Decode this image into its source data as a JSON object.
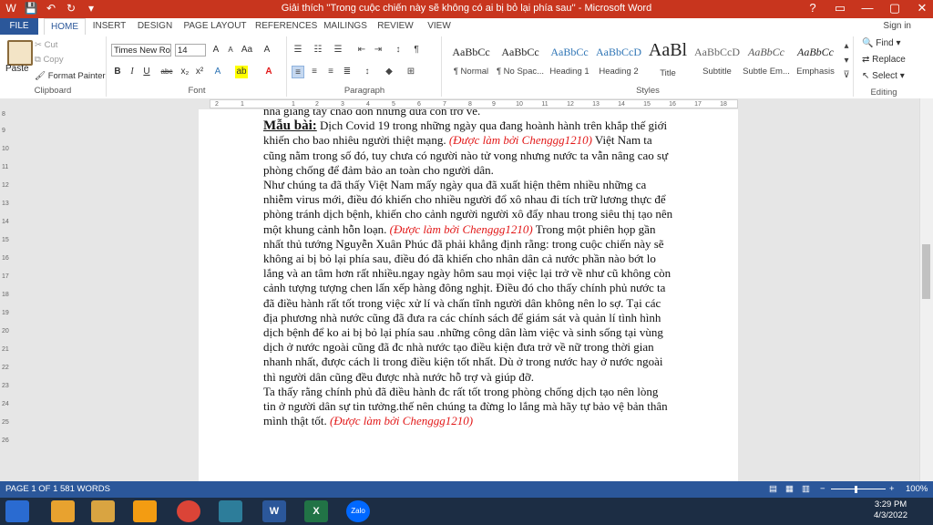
{
  "window": {
    "title": "Giải thích ''Trong cuộc chiến này sẽ không có ai bị bỏ lại phía sau'' - Microsoft Word",
    "controls": [
      "?",
      "▭",
      "—",
      "▢",
      "✕"
    ]
  },
  "tabs": [
    "FILE",
    "HOME",
    "INSERT",
    "DESIGN",
    "PAGE LAYOUT",
    "REFERENCES",
    "MAILINGS",
    "REVIEW",
    "VIEW"
  ],
  "signin": "Sign in",
  "ribbon": {
    "clipboard": {
      "paste": "Paste",
      "cut": "Cut",
      "copy": "Copy",
      "format_painter": "Format Painter",
      "label": "Clipboard"
    },
    "font": {
      "name": "Times New Ro",
      "size": "14",
      "label": "Font"
    },
    "paragraph": {
      "label": "Paragraph"
    },
    "styles": {
      "label": "Styles",
      "items": [
        {
          "sample": "AaBbCc",
          "name": "¶ Normal"
        },
        {
          "sample": "AaBbCc",
          "name": "¶ No Spac..."
        },
        {
          "sample": "AaBbCc",
          "name": "Heading 1"
        },
        {
          "sample": "AaBbCcD",
          "name": "Heading 2"
        },
        {
          "sample": "AaBl",
          "name": "Title"
        },
        {
          "sample": "AaBbCcD",
          "name": "Subtitle"
        },
        {
          "sample": "AaBbCc",
          "name": "Subtle Em..."
        },
        {
          "sample": "AaBbCc",
          "name": "Emphasis"
        }
      ]
    },
    "editing": {
      "find": "Find",
      "replace": "Replace",
      "select": "Select",
      "label": "Editing"
    }
  },
  "ruler_marks": [
    "2",
    "1",
    "1",
    "2",
    "3",
    "4",
    "5",
    "6",
    "7",
    "8",
    "9",
    "10",
    "11",
    "12",
    "13",
    "14",
    "15",
    "16",
    "17",
    "18"
  ],
  "vruler_marks": [
    "8",
    "9",
    "10",
    "11",
    "12",
    "13",
    "14",
    "15",
    "16",
    "17",
    "18",
    "19",
    "20",
    "21",
    "22",
    "23",
    "24",
    "25",
    "26"
  ],
  "document": {
    "p0": "nhà giang tay chào đón những đứa con trở về.",
    "p1_label": "Mẫu bài:",
    "p1_text": " Dịch Covid 19 trong những ngày qua đang hoành hành trên khắp thế giới khiến cho bao nhiêu người thiệt mạng. ",
    "credit": "(Được làm bởi Chenggg1210)",
    "p1_text2": " Việt Nam ta cũng nằm trong số đó, tuy chưa có người nào tử vong nhưng nước ta vẫn nâng cao sự phòng chống để đảm bảo an toàn cho người dân.",
    "p2_text": "Như chúng ta đã thấy Việt Nam mấy ngày qua đã xuất hiện thêm nhiều những ca nhiễm virus mới, điều đó khiến cho nhiều người đổ xô nhau đi tích trữ lương thực để phòng tránh dịch bệnh, khiến cho cảnh người người xô đẩy nhau trong siêu thị tạo nên một khung cảnh hỗn loạn. ",
    "p2_text2": " Trong một phiên họp gần nhất thủ tướng Nguyễn Xuân Phúc đã phải khẳng định rằng: trong cuộc chiến này sẽ không ai bị bỏ lại phía sau, điều đó đã khiến cho nhân dân cả nước phần nào bớt lo lắng và an tâm hơn rất nhiều.ngay ngày hôm sau mọi việc lại trở về như cũ không còn cảnh tượng tượng chen lấn xếp hàng đông nghịt. Điều đó cho thấy chính phủ nước ta đã điều hành rất tốt trong việc xử lí và chấn tĩnh người dân không nên lo sợ. Tại các địa phương nhà nước cũng đã đưa ra các chính sách để giám sát và quản lí tình hình dịch bệnh để ko ai bị bỏ lại phía sau .những công dân làm việc và sinh sống tại vùng dịch ở nước ngoài cũng đã đc nhà nước tạo điều kiện đưa trở về nữ trong thời gian nhanh nhất, được cách li trong điều kiện tốt nhất. Dù ở trong nước hay ở nước ngoài thì người dân cũng đều được nhà nước hỗ trợ và giúp đỡ.",
    "p3_text": "Ta thấy rằng chính phủ đã điều hành đc rất tốt trong phòng chống dịch tạo nên lòng tin ở người dân sự tin tưởng.thế nên chúng ta đừng lo lắng mà hãy tự bảo vệ bản thân mình thật tốt. "
  },
  "status": {
    "page": "PAGE 1 OF 1",
    "words": "581 WORDS",
    "zoom": "100%"
  },
  "taskbar": {
    "time": "3:29 PM",
    "date": "4/3/2022"
  },
  "colors": {
    "accent": "#2b579a",
    "titlebar": "#c8351e",
    "credit": "#e21818"
  }
}
